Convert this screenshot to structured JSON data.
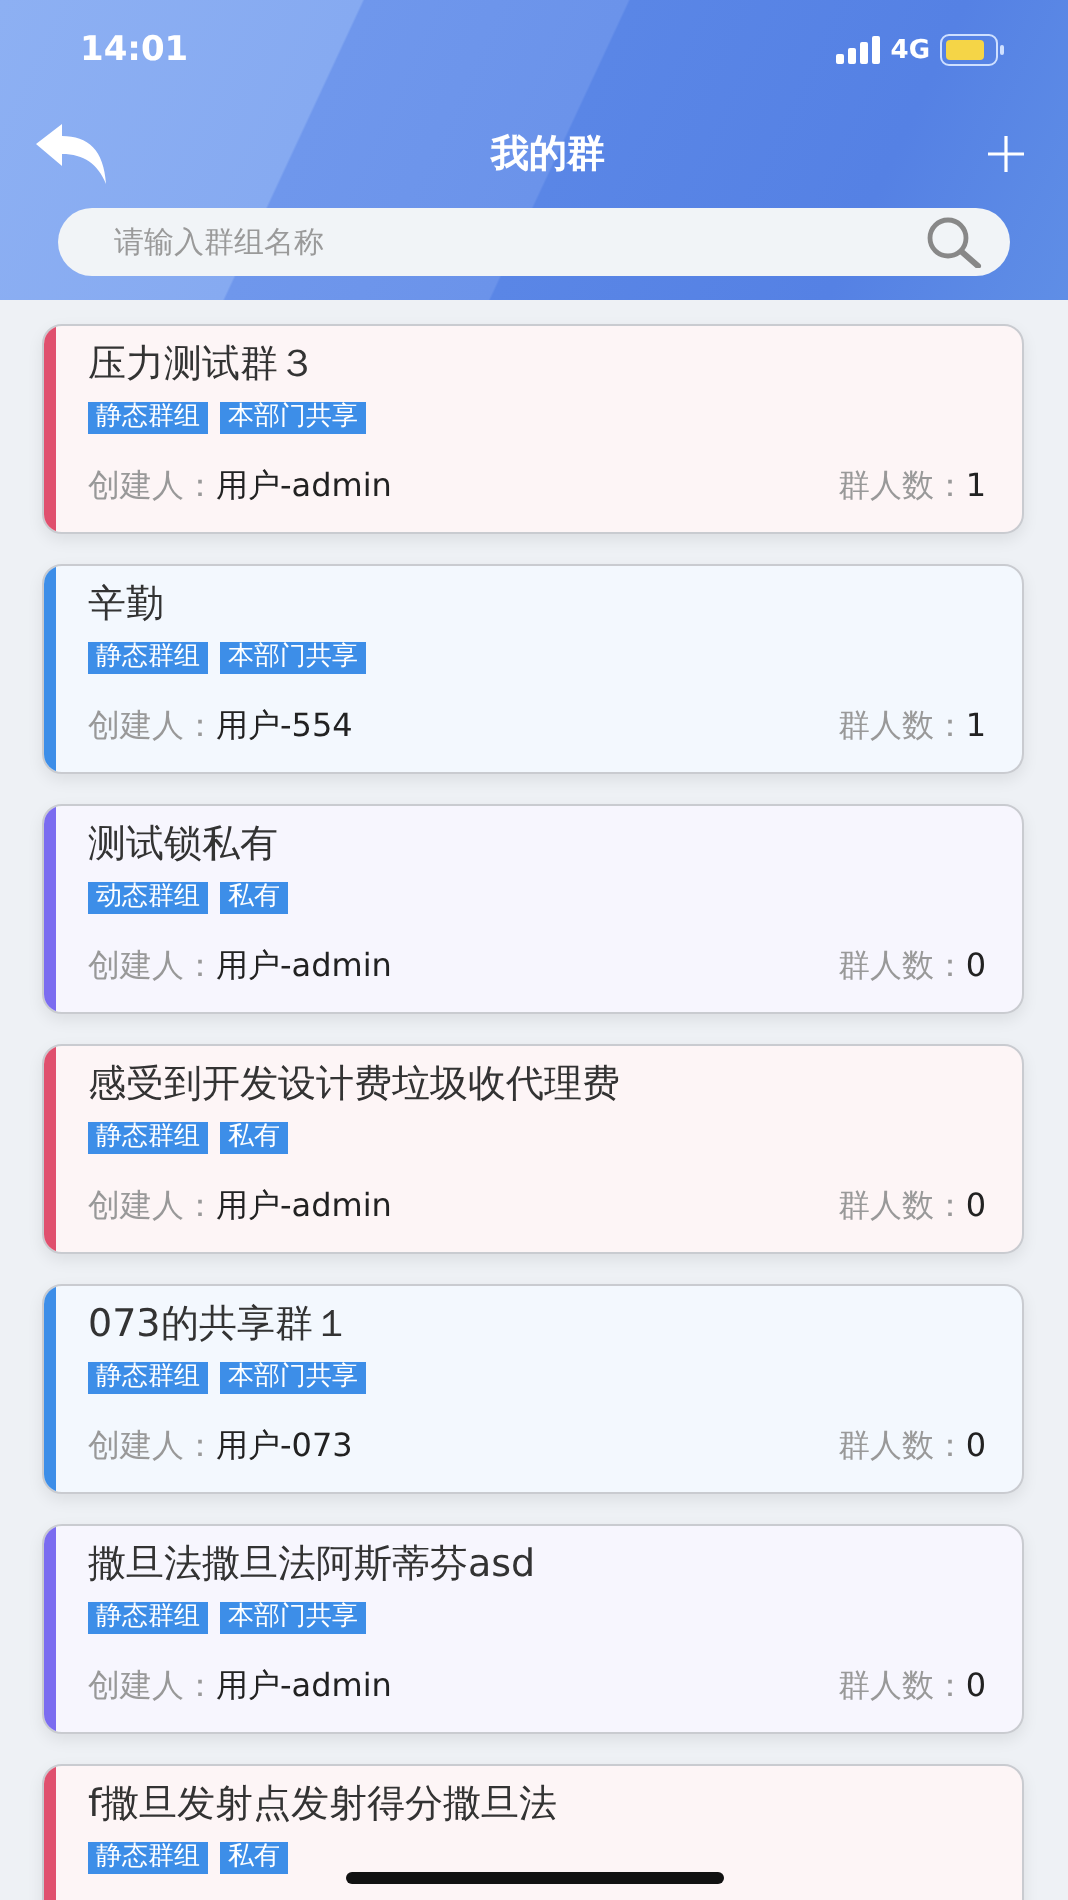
{
  "status_bar": {
    "time": "14:01",
    "network": "4G"
  },
  "nav": {
    "title": "我的群"
  },
  "search": {
    "placeholder": "请输入群组名称"
  },
  "groups": [
    {
      "name": "压力测试群３",
      "color": "#e0506e",
      "tags": [
        "静态群组",
        "本部门共享"
      ],
      "creator_label": "创建人：",
      "creator": "用户-admin",
      "count_label": "群人数：",
      "count": "1"
    },
    {
      "name": "辛勤",
      "color": "#3d8ee8",
      "tags": [
        "静态群组",
        "本部门共享"
      ],
      "creator_label": "创建人：",
      "creator": "用户-554",
      "count_label": "群人数：",
      "count": "1"
    },
    {
      "name": "测试锁私有",
      "color": "#7b6cf0",
      "tags": [
        "动态群组",
        "私有"
      ],
      "creator_label": "创建人：",
      "creator": "用户-admin",
      "count_label": "群人数：",
      "count": "0"
    },
    {
      "name": "感受到开发设计费垃圾收代理费",
      "color": "#e0506e",
      "tags": [
        "静态群组",
        "私有"
      ],
      "creator_label": "创建人：",
      "creator": "用户-admin",
      "count_label": "群人数：",
      "count": "0"
    },
    {
      "name": "073的共享群１",
      "color": "#3d8ee8",
      "tags": [
        "静态群组",
        "本部门共享"
      ],
      "creator_label": "创建人：",
      "creator": "用户-073",
      "count_label": "群人数：",
      "count": "0"
    },
    {
      "name": "撒旦法撒旦法阿斯蒂芬asd",
      "color": "#7b6cf0",
      "tags": [
        "静态群组",
        "本部门共享"
      ],
      "creator_label": "创建人：",
      "creator": "用户-admin",
      "count_label": "群人数：",
      "count": "0"
    },
    {
      "name": "f撒旦发射点发射得分撒旦法",
      "color": "#e0506e",
      "tags": [
        "静态群组",
        "私有"
      ]
    }
  ]
}
